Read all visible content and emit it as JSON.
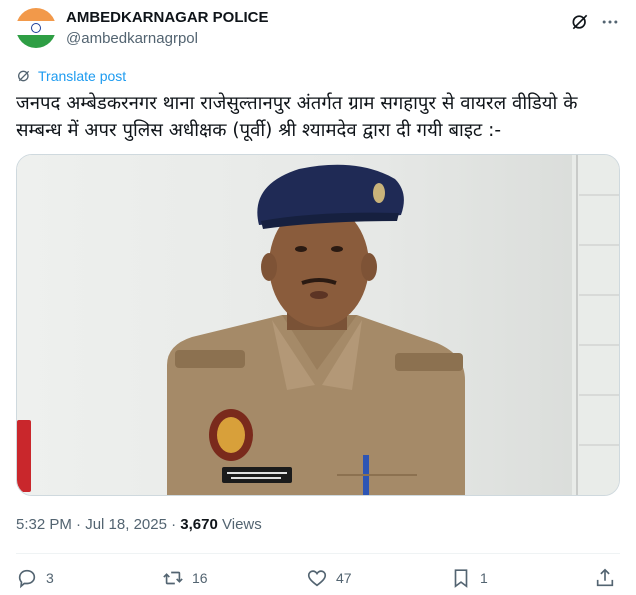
{
  "account": {
    "name": "AMBEDKARNAGAR POLICE",
    "handle": "@ambedkarnagrpol"
  },
  "translate_label": "Translate post",
  "post_text": "जनपद अम्बेडकरनगर थाना राजेसुल्तानपुर अंतर्गत ग्राम सगहापुर से वायरल वीडियो के सम्बन्ध में अपर पुलिस अधीक्षक (पूर्वी) श्री श्यामदेव द्वारा दी गयी बाइट :-",
  "meta": {
    "time": "5:32 PM",
    "date": "Jul 18, 2025",
    "views_count": "3,670",
    "views_label": "Views"
  },
  "actions": {
    "replies": "3",
    "reposts": "16",
    "likes": "47",
    "bookmarks": "1"
  },
  "colors": {
    "accent": "#1d9bf0",
    "secondary_text": "#536471",
    "flag_saffron": "#f2994a",
    "flag_green": "#2e9e44"
  }
}
